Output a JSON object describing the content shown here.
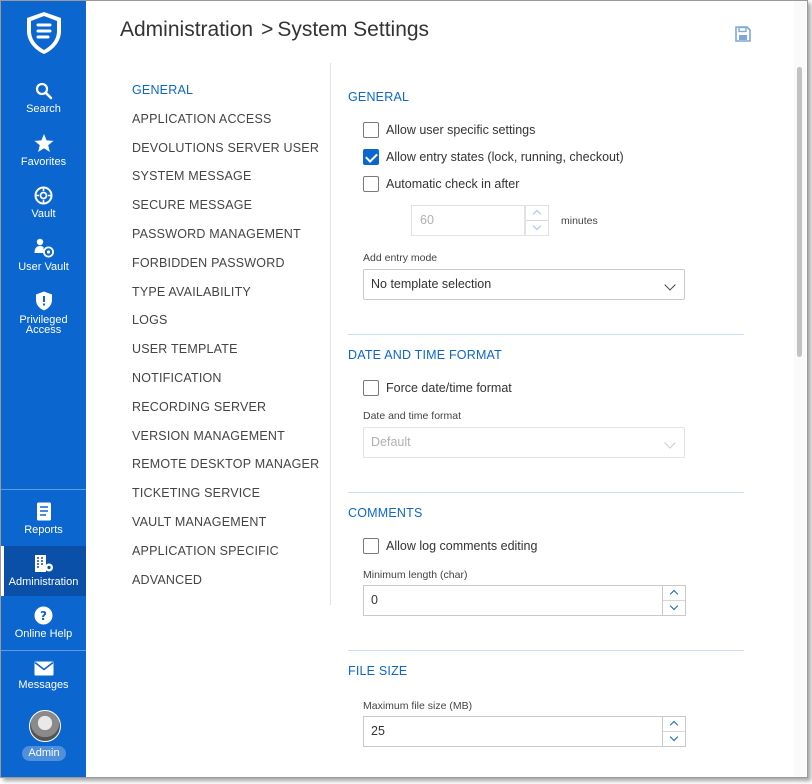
{
  "rail": {
    "items": [
      {
        "label": "Search",
        "icon": "search-icon"
      },
      {
        "label": "Favorites",
        "icon": "star-icon"
      },
      {
        "label": "Vault",
        "icon": "vault-icon"
      },
      {
        "label": "User Vault",
        "icon": "user-vault-icon"
      },
      {
        "label": "Privileged Access",
        "icon": "shield-icon"
      },
      {
        "label": "Reports",
        "icon": "reports-icon"
      },
      {
        "label": "Administration",
        "icon": "administration-icon"
      },
      {
        "label": "Online Help",
        "icon": "help-icon"
      },
      {
        "label": "Messages",
        "icon": "envelope-icon"
      }
    ],
    "user_badge": "Admin",
    "active_item": "Administration",
    "accent_color": "#0b66d0"
  },
  "header": {
    "breadcrumb_root": "Administration",
    "breadcrumb_separator": ">",
    "breadcrumb_current": "System Settings",
    "save_icon": "save-icon"
  },
  "settings_nav": {
    "active": "GENERAL",
    "items": [
      "GENERAL",
      "APPLICATION ACCESS",
      "DEVOLUTIONS SERVER USER",
      "SYSTEM MESSAGE",
      "SECURE MESSAGE",
      "PASSWORD MANAGEMENT",
      "FORBIDDEN PASSWORD",
      "TYPE AVAILABILITY",
      "LOGS",
      "USER TEMPLATE",
      "NOTIFICATION",
      "RECORDING SERVER",
      "VERSION MANAGEMENT",
      "REMOTE DESKTOP MANAGER",
      "TICKETING SERVICE",
      "VAULT MANAGEMENT",
      "APPLICATION SPECIFIC",
      "ADVANCED"
    ]
  },
  "general": {
    "title": "GENERAL",
    "allow_user_specific": {
      "label": "Allow user specific settings",
      "checked": false
    },
    "allow_entry_states": {
      "label": "Allow entry states (lock, running, checkout)",
      "checked": true
    },
    "auto_check_in": {
      "label": "Automatic check in after",
      "checked": false
    },
    "check_in_value": "60",
    "check_in_unit": "minutes",
    "add_entry_mode_label": "Add entry mode",
    "add_entry_mode_value": "No template selection"
  },
  "date_time": {
    "title": "DATE AND TIME FORMAT",
    "force_format": {
      "label": "Force date/time format",
      "checked": false
    },
    "format_label": "Date and time format",
    "format_value": "Default"
  },
  "comments": {
    "title": "COMMENTS",
    "allow_log_comments": {
      "label": "Allow log comments editing",
      "checked": false
    },
    "min_length_label": "Minimum length (char)",
    "min_length_value": "0"
  },
  "file_size": {
    "title": "FILE SIZE",
    "max_label": "Maximum file size (MB)",
    "max_value": "25"
  }
}
